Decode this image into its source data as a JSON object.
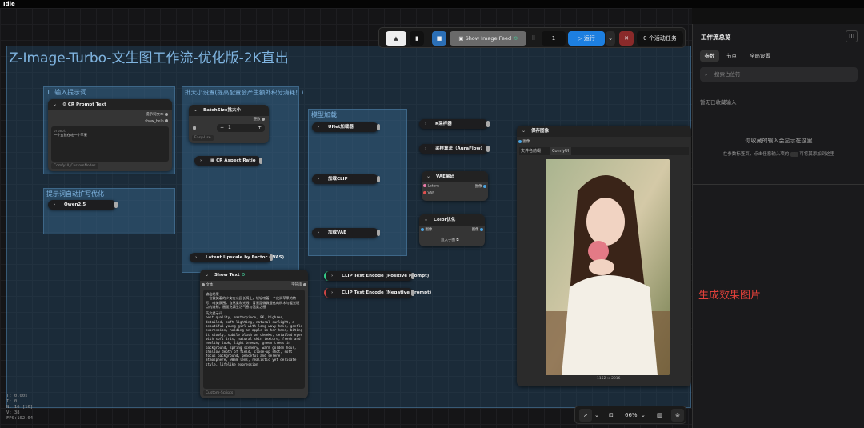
{
  "titlebar": {
    "status": "Idle"
  },
  "main_title": "Z-Image-Turbo-文生图工作流-优化版-2K直出",
  "groups": {
    "input_prompt": "1. 输入提示词",
    "prompt_expand": "提示词自动扩写优化",
    "batch_size": "批大小设置(提高配置会产生额外积分消耗！)",
    "model_load": "模型加载"
  },
  "nodes": {
    "cr_prompt": {
      "title": "CR Prompt Text",
      "out1": "提示词文本",
      "out2": "show_help",
      "label": "prompt",
      "text": "一个女孩在吃一个苹果",
      "footer": "ComfyUI_CustomNodes"
    },
    "qwen": {
      "title": "Qwen2.5"
    },
    "batch": {
      "title": "BatchSize批大小",
      "out": "整数",
      "value": "1",
      "footer": "Easy-Use"
    },
    "aspect": {
      "title": "CR Aspect Ratio"
    },
    "unet": {
      "title": "UNet加载器"
    },
    "clip": {
      "title": "加载CLIP"
    },
    "vae": {
      "title": "加载VAE"
    },
    "ksampler": {
      "title": "K采样器"
    },
    "auraflow": {
      "title": "采样算法（AuraFlow）"
    },
    "vae_decode": {
      "title": "VAE解码",
      "in1": "Latent",
      "in2": "VAE",
      "out": "图像"
    },
    "color": {
      "title": "Color优化",
      "in": "图像",
      "out": "图像",
      "btn": "追入子图"
    },
    "latent_upscale": {
      "title": "Latent Upscale by Factor (WAS)"
    },
    "show_text": {
      "title": "Show Text",
      "in": "文本",
      "out": "字符串",
      "footer": "Custom-Scripts",
      "heading1": "输出结果",
      "text1": "一位微笑着的少女在公园长椅上，轻轻咬着一个红润苹果的特写，唯美氛围，自然柔和光线，背景是微微虚化的树木与暖光斑点的溢射，画面充满生活气息与温柔之感",
      "heading2": "英文提示词",
      "text2": "best quality, masterpiece, 8K, highres, detailed, soft lighting, natural sunlight, a beautiful young girl with long wavy hair, gentle expression, holding an apple in her hand, biting it slowly, subtle blush on cheeks, detailed eyes with soft iris, natural skin texture, fresh and healthy look, light breeze, green trees in background, spring scenery, warm golden hour, shallow depth of field, close-up shot, soft focus background, peaceful and serene atmosphere, 90mm lens, realistic yet delicate style, lifelike expression"
    },
    "clip_pos": {
      "title": "CLIP Text Encode (Positive Prompt)"
    },
    "clip_neg": {
      "title": "CLIP Text Encode (Negative Prompt)"
    },
    "save_image": {
      "title": "保存图像",
      "in": "图像",
      "field_label": "文件名前缀",
      "field_value": "ComfyUI",
      "caption": "1152 × 2016"
    }
  },
  "toolbar": {
    "show_feed": "Show Image Feed",
    "count": "1",
    "run": "运行",
    "active": "0 个活动任务"
  },
  "sidepanel": {
    "title": "工作流总览",
    "tabs": [
      "参数",
      "节点",
      "全局设置"
    ],
    "search_placeholder": "搜索占位符",
    "empty_title": "暂无已收藏输入",
    "empty_msg": "你收藏的输入会显示在这里",
    "hint_pre": "在参数标签页，点击任意输入项的",
    "hint_post": "可将其添加到这里"
  },
  "annotation": "生成效果图片",
  "status": {
    "t": "T: 0.00s",
    "i": "I: 0",
    "n": "N: 16 [16]",
    "v": "V: 38",
    "fps": "FPS:102.04"
  },
  "bottombar": {
    "zoom": "66%"
  }
}
